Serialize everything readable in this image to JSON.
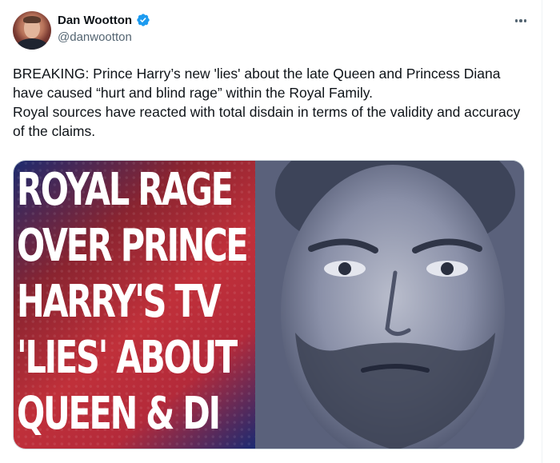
{
  "author": {
    "display_name": "Dan Wootton",
    "handle": "@danwootton",
    "verified": true,
    "verified_color": "#1d9bf0"
  },
  "tweet": {
    "lines": [
      "BREAKING: Prince Harry’s new 'lies' about the late Queen and Princess Diana have caused “hurt and blind rage” within the Royal Family.",
      "Royal sources have reacted with total disdain in terms of the validity and accuracy of the claims."
    ]
  },
  "media": {
    "headline_lines": [
      "ROYAL RAGE",
      "OVER PRINCE",
      "HARRY'S TV",
      "'LIES' ABOUT",
      "QUEEN & DI"
    ],
    "portrait_icon": "portrait-photo"
  },
  "icons": {
    "more": "more-options-icon",
    "verified": "verified-badge-icon"
  }
}
